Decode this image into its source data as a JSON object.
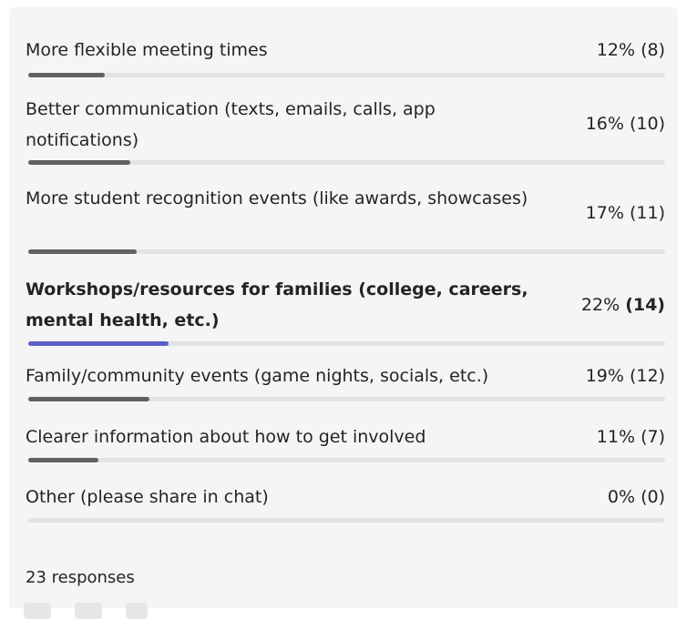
{
  "poll": {
    "options": [
      {
        "label": "More flexible meeting times",
        "percent_text": "12%",
        "count_text": "(8)",
        "fraction": 0.12,
        "selected": false
      },
      {
        "label": "Better communication (texts, emails, calls, app notifications)",
        "percent_text": "16%",
        "count_text": "(10)",
        "fraction": 0.16,
        "selected": false
      },
      {
        "label": "More student recognition events (like awards, showcases)",
        "percent_text": "17%",
        "count_text": "(11)",
        "fraction": 0.17,
        "selected": false
      },
      {
        "label": "Workshops/resources for families (college, careers, mental health, etc.)",
        "percent_text": "22%",
        "count_text": "(14)",
        "fraction": 0.22,
        "selected": true
      },
      {
        "label": "Family/community events (game nights, socials, etc.)",
        "percent_text": "19%",
        "count_text": "(12)",
        "fraction": 0.19,
        "selected": false
      },
      {
        "label": "Clearer information about how to get involved",
        "percent_text": "11%",
        "count_text": "(7)",
        "fraction": 0.11,
        "selected": false
      },
      {
        "label": "Other (please share in chat)",
        "percent_text": "0%",
        "count_text": "(0)",
        "fraction": 0.0,
        "selected": false
      }
    ],
    "responses_label": "23 responses"
  },
  "colors": {
    "panel_background": "#f5f5f5",
    "bar_track": "#e3e3e3",
    "bar_fill": "#616161",
    "bar_fill_selected": "#5b5fc7"
  }
}
